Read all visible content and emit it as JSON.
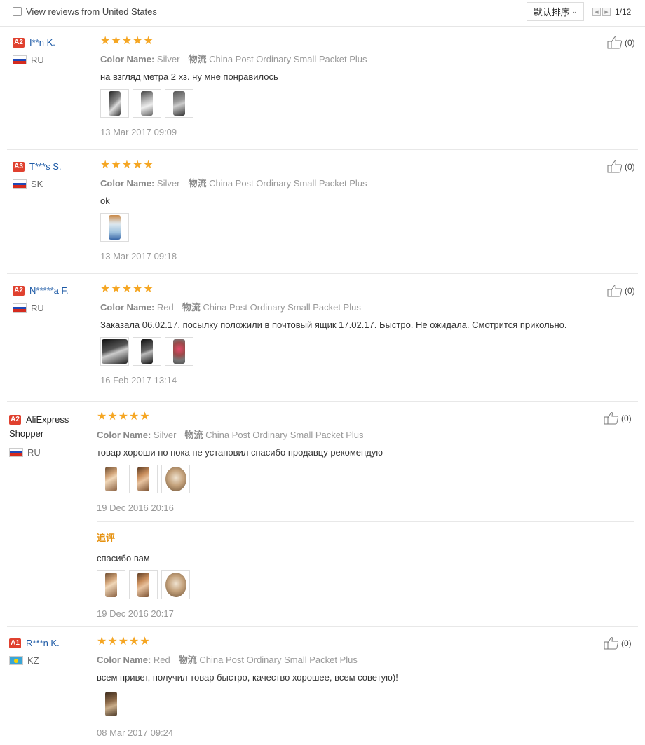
{
  "filter": {
    "label": "View reviews from United States",
    "checked": false
  },
  "sort": {
    "label": "默认排序"
  },
  "pager": {
    "page": "1/12"
  },
  "labels": {
    "color_name": "Color Name:",
    "shipping": "物流",
    "additional": "追评"
  },
  "colors": {
    "star": "#f5a623",
    "buyer_link": "#1d5aa6",
    "level_badge": "#e0412f",
    "additional_label": "#e69313"
  },
  "reviews": [
    {
      "level": "A2",
      "name": "I**n K.",
      "country": "RU",
      "flag": [
        "#ffffff",
        "#1f49b7",
        "#d52b1e"
      ],
      "stars": "★★★★★",
      "rating": 5,
      "color": "Silver",
      "shipping": "China Post Ordinary Small Packet Plus",
      "text": "на взгляд метра 2 хз. ну мне понравилось",
      "photo_count": 3,
      "date": "13 Mar 2017 09:09",
      "likes": "(0)"
    },
    {
      "level": "A3",
      "name": "T***s S.",
      "country": "SK",
      "flag": [
        "#ffffff",
        "#1f49b7",
        "#d52b1e"
      ],
      "stars": "★★★★★",
      "rating": 5,
      "color": "Silver",
      "shipping": "China Post Ordinary Small Packet Plus",
      "text": "ok",
      "photo_count": 1,
      "date": "13 Mar 2017 09:18",
      "likes": "(0)"
    },
    {
      "level": "A2",
      "name": "N*****a F.",
      "country": "RU",
      "flag": [
        "#ffffff",
        "#1f49b7",
        "#d52b1e"
      ],
      "stars": "★★★★★",
      "rating": 5,
      "color": "Red",
      "shipping": "China Post Ordinary Small Packet Plus",
      "text": "Заказала 06.02.17, посылку положили в почтовый ящик 17.02.17. Быстро. Не ожидала. Смотрится прикольно.",
      "photo_count": 3,
      "date": "16 Feb 2017 13:14",
      "likes": "(0)"
    },
    {
      "level": "A2",
      "name": "AliExpress Shopper",
      "country": "RU",
      "flag": [
        "#ffffff",
        "#1f49b7",
        "#d52b1e"
      ],
      "stars": "★★★★★",
      "rating": 5,
      "color": "Silver",
      "shipping": "China Post Ordinary Small Packet Plus",
      "text": "товар хороши но пока не установил спасибо продавцу рекомендую",
      "photo_count": 3,
      "date": "19 Dec 2016 20:16",
      "likes": "(0)",
      "additional": {
        "text": "спасибо вам",
        "photo_count": 3,
        "date": "19 Dec 2016 20:17"
      }
    },
    {
      "level": "A1",
      "name": "R***n K.",
      "country": "KZ",
      "flag": [
        "#3aa6d6",
        "#3aa6d6",
        "#3aa6d6"
      ],
      "stars": "★★★★★",
      "rating": 5,
      "color": "Red",
      "shipping": "China Post Ordinary Small Packet Plus",
      "text": "всем привет, получил товар быстро, качество хорошее, всем советую)!",
      "photo_count": 1,
      "date": "08 Mar 2017 09:24",
      "likes": "(0)"
    }
  ]
}
